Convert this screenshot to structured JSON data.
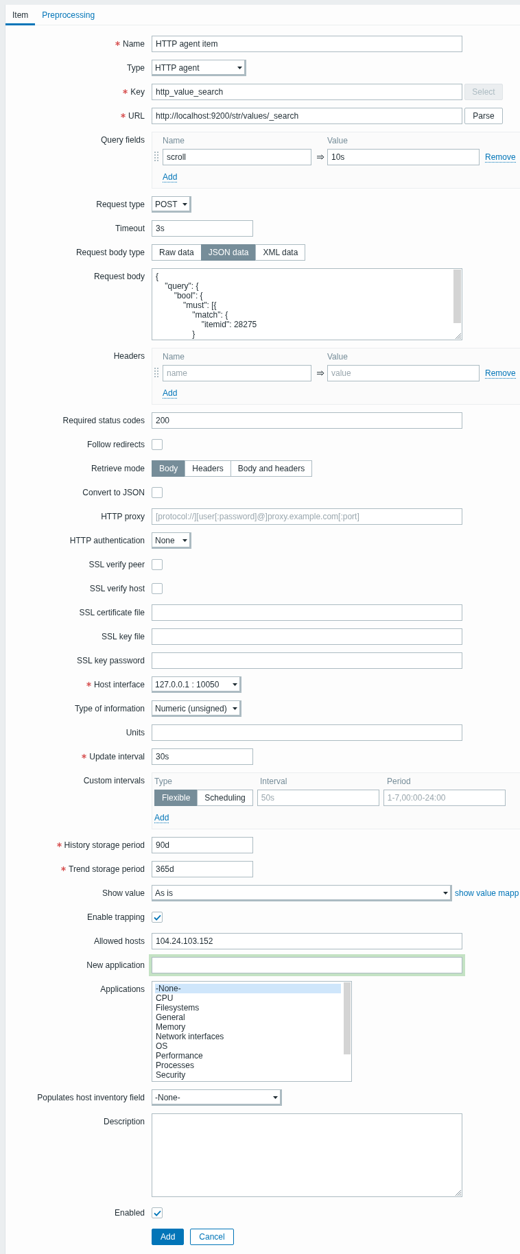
{
  "tabs": [
    {
      "label": "Item",
      "selected": true
    },
    {
      "label": "Preprocessing",
      "selected": false
    }
  ],
  "rows": [
    {
      "kind": "input",
      "label": "Name",
      "required": true,
      "value": "HTTP agent item"
    },
    {
      "kind": "select",
      "label": "Type",
      "required": false,
      "value": "HTTP agent"
    },
    {
      "kind": "input",
      "label": "Key",
      "required": true,
      "value": "http_value_search",
      "button": {
        "label": "Select",
        "disabled": true
      }
    },
    {
      "kind": "input",
      "label": "URL",
      "required": true,
      "value": "http://localhost:9200/str/values/_search",
      "button": {
        "label": "Parse",
        "disabled": false
      }
    },
    {
      "kind": "pairs",
      "label": "Query fields",
      "required": false,
      "columns": [
        "Name",
        "Value"
      ],
      "pairs": [
        {
          "name": {
            "value": "scroll"
          },
          "value": {
            "value": "10s"
          },
          "remove": "Remove"
        }
      ],
      "add": "Add"
    },
    {
      "kind": "select",
      "label": "Request type",
      "required": false,
      "value": "POST"
    },
    {
      "kind": "short_input",
      "label": "Timeout",
      "required": false,
      "value": "3s"
    },
    {
      "kind": "segmented",
      "label": "Request body type",
      "required": false,
      "options": [
        {
          "label": "Raw data",
          "selected": false
        },
        {
          "label": "JSON data",
          "selected": true
        },
        {
          "label": "XML data",
          "selected": false
        }
      ]
    },
    {
      "kind": "textarea",
      "label": "Request body",
      "required": false,
      "value": "{\n    \"query\": {\n        \"bool\": {\n            \"must\": [{\n                \"match\": {\n                    \"itemid\": 28275\n                }"
    },
    {
      "kind": "pairs",
      "label": "Headers",
      "required": false,
      "columns": [
        "Name",
        "Value"
      ],
      "pairs": [
        {
          "name": {
            "placeholder": "name"
          },
          "value": {
            "placeholder": "value"
          },
          "remove": "Remove"
        }
      ],
      "add": "Add"
    },
    {
      "kind": "input",
      "label": "Required status codes",
      "required": false,
      "value": "200"
    },
    {
      "kind": "checkbox",
      "label": "Follow redirects",
      "required": false,
      "checked": false
    },
    {
      "kind": "segmented",
      "label": "Retrieve mode",
      "required": false,
      "options": [
        {
          "label": "Body",
          "selected": true
        },
        {
          "label": "Headers",
          "selected": false
        },
        {
          "label": "Body and headers",
          "selected": false
        }
      ]
    },
    {
      "kind": "checkbox",
      "label": "Convert to JSON",
      "required": false,
      "checked": false
    },
    {
      "kind": "input",
      "label": "HTTP proxy",
      "required": false,
      "placeholder": "[protocol://][user[:password]@]proxy.example.com[:port]"
    },
    {
      "kind": "select",
      "label": "HTTP authentication",
      "required": false,
      "value": "None"
    },
    {
      "kind": "checkbox",
      "label": "SSL verify peer",
      "required": false,
      "checked": false
    },
    {
      "kind": "checkbox",
      "label": "SSL verify host",
      "required": false,
      "checked": false
    },
    {
      "kind": "input",
      "label": "SSL certificate file",
      "required": false
    },
    {
      "kind": "input",
      "label": "SSL key file",
      "required": false
    },
    {
      "kind": "input",
      "label": "SSL key password",
      "required": false
    },
    {
      "kind": "select",
      "label": "Host interface",
      "required": true,
      "value": "127.0.0.1 : 10050"
    },
    {
      "kind": "select",
      "label": "Type of information",
      "required": false,
      "value": "Numeric (unsigned)"
    },
    {
      "kind": "input",
      "label": "Units",
      "required": false
    },
    {
      "kind": "short_input",
      "label": "Update interval",
      "required": true,
      "value": "30s"
    },
    {
      "kind": "intervals",
      "label": "Custom intervals",
      "required": false,
      "columns": [
        "Type",
        "Interval",
        "Period"
      ],
      "entries": [
        {
          "options": [
            {
              "label": "Flexible",
              "selected": true
            },
            {
              "label": "Scheduling",
              "selected": false
            }
          ],
          "interval": {
            "placeholder": "50s"
          },
          "period": {
            "placeholder": "1-7,00:00-24:00"
          }
        }
      ],
      "add": "Add"
    },
    {
      "kind": "short_input",
      "label": "History storage period",
      "required": true,
      "value": "90d"
    },
    {
      "kind": "short_input",
      "label": "Trend storage period",
      "required": true,
      "value": "365d"
    },
    {
      "kind": "select",
      "label": "Show value",
      "required": false,
      "value": "As is",
      "link": "show value mapp"
    },
    {
      "kind": "checkbox",
      "label": "Enable trapping",
      "required": false,
      "checked": true
    },
    {
      "kind": "input",
      "label": "Allowed hosts",
      "required": false,
      "value": "104.24.103.152"
    },
    {
      "kind": "input",
      "label": "New application",
      "required": false,
      "focused": true
    },
    {
      "kind": "listbox",
      "label": "Applications",
      "required": false,
      "options": [
        {
          "label": "-None-",
          "selected": true
        },
        {
          "label": "CPU",
          "selected": false
        },
        {
          "label": "Filesystems",
          "selected": false
        },
        {
          "label": "General",
          "selected": false
        },
        {
          "label": "Memory",
          "selected": false
        },
        {
          "label": "Network interfaces",
          "selected": false
        },
        {
          "label": "OS",
          "selected": false
        },
        {
          "label": "Performance",
          "selected": false
        },
        {
          "label": "Processes",
          "selected": false
        },
        {
          "label": "Security",
          "selected": false
        }
      ]
    },
    {
      "kind": "select",
      "label": "Populates host inventory field",
      "required": false,
      "value": "-None-"
    },
    {
      "kind": "textarea",
      "label": "Description",
      "required": false
    },
    {
      "kind": "checkbox",
      "label": "Enabled",
      "required": false,
      "checked": true
    }
  ],
  "buttons": [
    {
      "label": "Add",
      "kind": "primary"
    },
    {
      "label": "Cancel",
      "kind": "secondary"
    }
  ]
}
